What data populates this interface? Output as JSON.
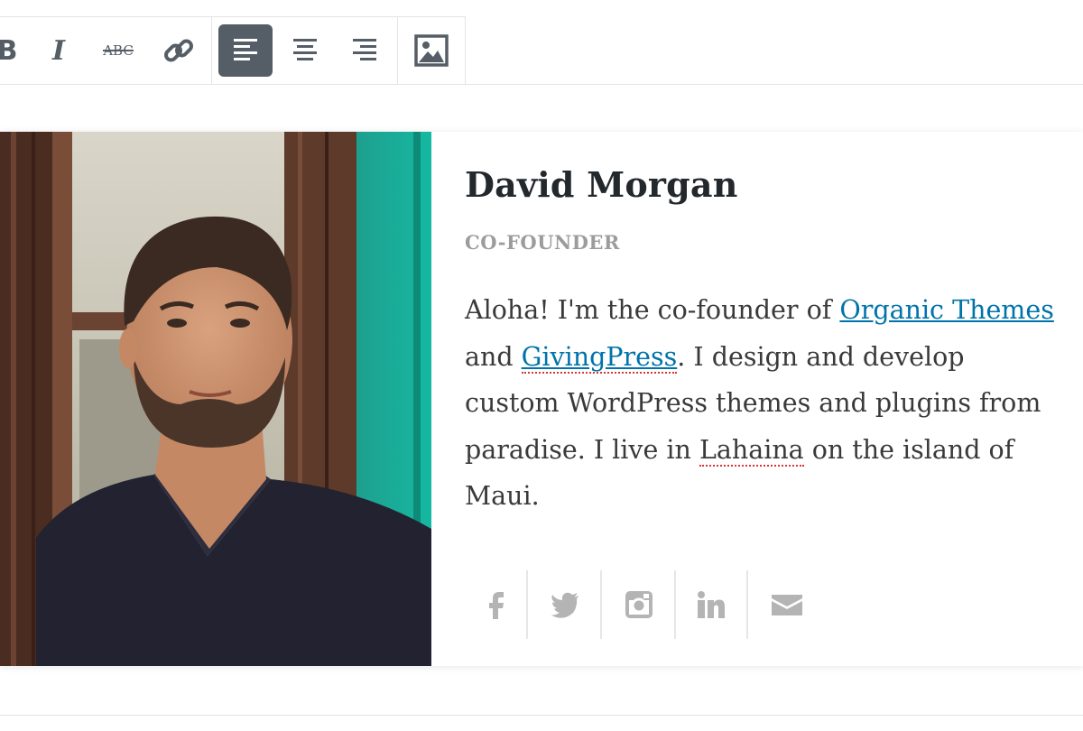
{
  "toolbar": {
    "buttons": [
      {
        "name": "bold",
        "icon": "bold-icon",
        "label": "B",
        "active": false
      },
      {
        "name": "italic",
        "icon": "italic-icon",
        "label": "I",
        "active": false
      },
      {
        "name": "strikethrough",
        "icon": "strikethrough-icon",
        "label": "ABC",
        "active": false
      },
      {
        "name": "link",
        "icon": "link-icon",
        "active": false
      },
      {
        "name": "align-left",
        "icon": "align-left-icon",
        "active": true
      },
      {
        "name": "align-center",
        "icon": "align-center-icon",
        "active": false
      },
      {
        "name": "align-right",
        "icon": "align-right-icon",
        "active": false
      },
      {
        "name": "image",
        "icon": "image-icon",
        "active": false
      }
    ],
    "active_color": "#555d66",
    "icon_color": "#555d66"
  },
  "profile": {
    "name": "David Morgan",
    "role": "CO-FOUNDER",
    "bio": {
      "intro": "Aloha! I'm the co-founder of ",
      "link1": "Organic Themes",
      "and": " and ",
      "link2": "GivingPress",
      "middle": ". I design and develop custom WordPress themes and plugins from paradise. I live in ",
      "place": "Lahaina",
      "end": " on the island of Maui."
    },
    "link_color": "#0073aa",
    "social": [
      "facebook-icon",
      "twitter-icon",
      "instagram-icon",
      "linkedin-icon",
      "email-icon"
    ],
    "social_color": "#b4b4b4"
  }
}
